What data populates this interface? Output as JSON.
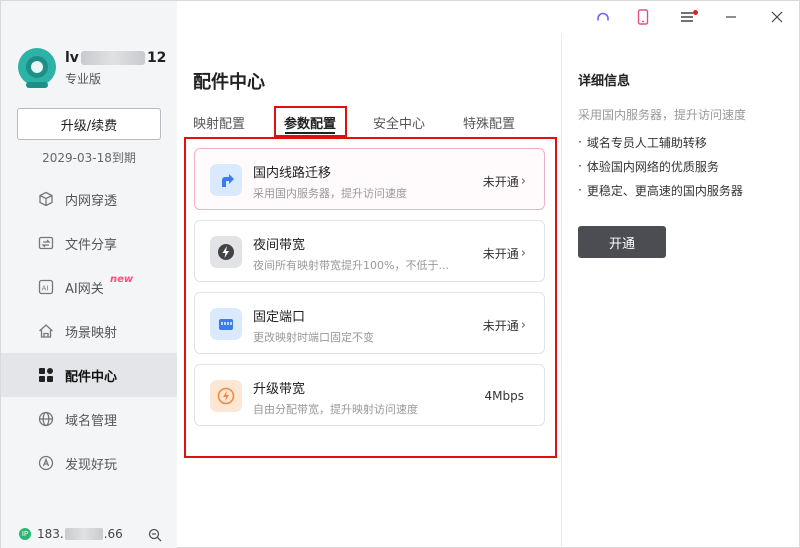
{
  "user": {
    "name_prefix": "lv",
    "name_suffix": "12",
    "edition": "专业版"
  },
  "sidebar": {
    "upgrade_label": "升级/续费",
    "expire_text": "2029-03-18到期",
    "items": [
      {
        "label": "内网穿透",
        "icon": "cube-icon"
      },
      {
        "label": "文件分享",
        "icon": "folder-share-icon"
      },
      {
        "label": "AI网关",
        "icon": "ai-icon",
        "badge": "new"
      },
      {
        "label": "场景映射",
        "icon": "house-icon"
      },
      {
        "label": "配件中心",
        "icon": "grid-icon",
        "active": true
      },
      {
        "label": "域名管理",
        "icon": "globe-icon"
      },
      {
        "label": "发现好玩",
        "icon": "compass-icon"
      }
    ],
    "ip_prefix": "183.",
    "ip_suffix": ".66"
  },
  "main": {
    "title": "配件中心",
    "tabs": [
      {
        "label": "映射配置"
      },
      {
        "label": "参数配置",
        "active": true
      },
      {
        "label": "安全中心"
      },
      {
        "label": "特殊配置"
      }
    ],
    "cards": [
      {
        "title": "国内线路迁移",
        "desc": "采用国内服务器，提升访问速度",
        "status": "未开通",
        "chevron": "›",
        "icon": "route-icon",
        "icon_bg": "#dbe9ff",
        "icon_fg": "#3a7bf0"
      },
      {
        "title": "夜间带宽",
        "desc": "夜间所有映射带宽提升100%，不低于...",
        "status": "未开通",
        "chevron": "›",
        "icon": "bolt-icon",
        "icon_bg": "#e2e3e6",
        "icon_fg": "#444444"
      },
      {
        "title": "固定端口",
        "desc": "更改映射时端口固定不变",
        "status": "未开通",
        "chevron": "›",
        "icon": "port-icon",
        "icon_bg": "#dbe9ff",
        "icon_fg": "#3a7bf0"
      },
      {
        "title": "升级带宽",
        "desc": "自由分配带宽，提升映射访问速度",
        "status": "4Mbps",
        "chevron": "",
        "icon": "bandwidth-icon",
        "icon_bg": "#fde6d4",
        "icon_fg": "#f08a3c"
      }
    ]
  },
  "detail": {
    "title": "详细信息",
    "desc": "采用国内服务器，提升访问速度",
    "bullets": [
      "域名专员人工辅助转移",
      "体验国内网络的优质服务",
      "更稳定、更高速的国内服务器"
    ],
    "bullet_mark": "·",
    "button_label": "开通"
  },
  "colors": {
    "highlight": "#e01010",
    "new_badge": "#ff4d7a",
    "status_online": "#2bb673",
    "primary_button": "#4b4d52"
  }
}
